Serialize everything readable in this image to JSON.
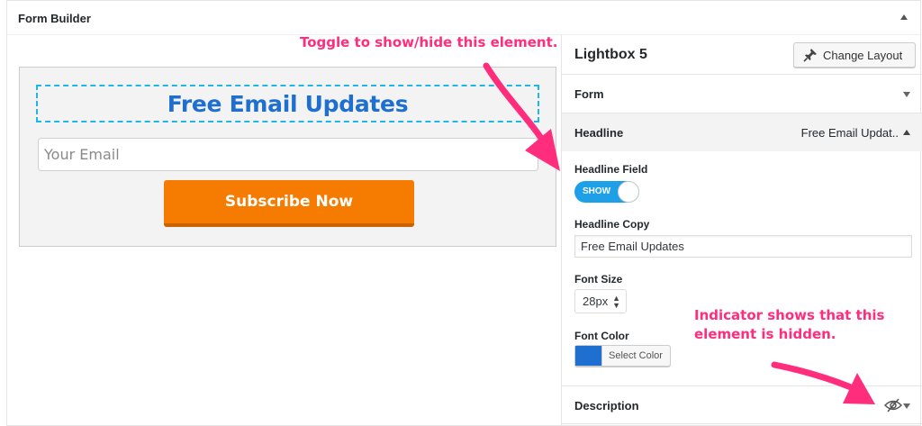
{
  "panel": {
    "title": "Form Builder"
  },
  "preview": {
    "headline": "Free Email Updates",
    "email_placeholder": "Your Email",
    "subscribe_label": "Subscribe Now"
  },
  "settings": {
    "lightbox_title": "Lightbox 5",
    "change_layout_label": "Change Layout",
    "sections": {
      "form": "Form",
      "headline": "Headline",
      "headline_summary": "Free Email Updat..",
      "description": "Description"
    },
    "headline_field": {
      "label": "Headline Field",
      "toggle_text": "SHOW",
      "enabled": true
    },
    "headline_copy": {
      "label": "Headline Copy",
      "value": "Free Email Updates"
    },
    "font_size": {
      "label": "Font Size",
      "value": "28px"
    },
    "font_color": {
      "label": "Font Color",
      "button_label": "Select Color",
      "swatch": "#1f6fd1"
    },
    "description_hidden_icon": "eye-slash-icon"
  },
  "annotations": {
    "toggle_note": "Toggle to show/hide this element.",
    "hidden_note_line1": "Indicator shows that this",
    "hidden_note_line2": "element is hidden."
  },
  "colors": {
    "accent_blue": "#1f6fd1",
    "toggle_blue": "#1ea0e8",
    "subscribe_orange": "#f57c00",
    "annotation_pink": "#ff2d7c",
    "dashed_outline": "#1fb6e8"
  }
}
